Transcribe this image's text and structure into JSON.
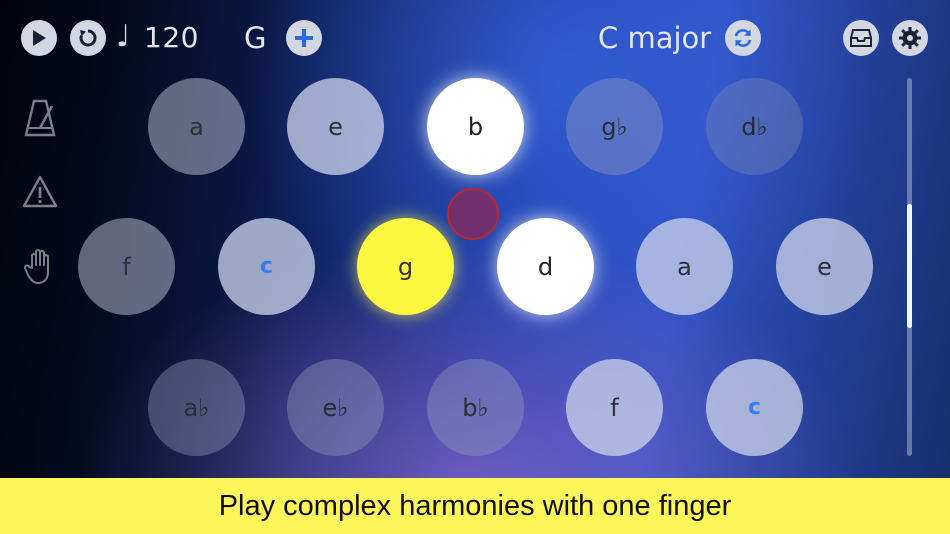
{
  "topbar": {
    "tempo_symbol": "♩",
    "tempo_value": "120",
    "key_root": "G",
    "scale": "C major"
  },
  "icons": {
    "play": "play-icon",
    "reset": "reset-icon",
    "add": "plus-icon",
    "swap_scale": "refresh-icon",
    "inbox": "inbox-icon",
    "settings": "gear-icon",
    "metronome": "metronome-icon",
    "warning": "warning-icon",
    "hand": "hand-icon"
  },
  "pads": {
    "row1": [
      {
        "label": "a",
        "state": "dim"
      },
      {
        "label": "e",
        "state": "light"
      },
      {
        "label": "b",
        "state": "active-white"
      },
      {
        "label": "g♭",
        "state": "faint"
      },
      {
        "label": "d♭",
        "state": "fainter"
      }
    ],
    "row2": [
      {
        "label": "f",
        "state": "dim"
      },
      {
        "label": "c",
        "state": "light-root"
      },
      {
        "label": "g",
        "state": "active-yellow"
      },
      {
        "label": "d",
        "state": "active-white"
      },
      {
        "label": "a",
        "state": "light"
      },
      {
        "label": "e",
        "state": "light"
      }
    ],
    "row3": [
      {
        "label": "a♭",
        "state": "faint"
      },
      {
        "label": "e♭",
        "state": "faint"
      },
      {
        "label": "b♭",
        "state": "faint"
      },
      {
        "label": "f",
        "state": "light"
      },
      {
        "label": "c",
        "state": "light-root"
      }
    ]
  },
  "slider": {
    "level_fraction": 0.33
  },
  "caption": "Play complex harmonies with one finger",
  "colors": {
    "active_yellow": "#fbf83f",
    "root_note_blue": "#3b7cf0",
    "caption_bg": "#fcf65a",
    "touch_marker": "#b8262f"
  }
}
